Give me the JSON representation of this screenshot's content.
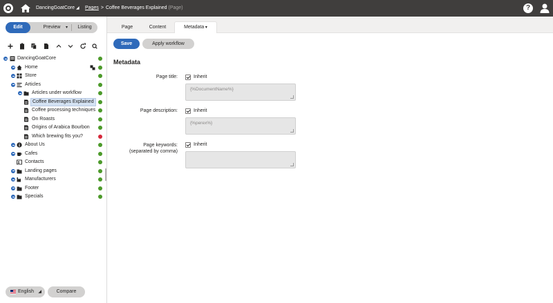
{
  "topbar": {
    "site_name": "DancingGoatCore",
    "breadcrumb_pages": "Pages",
    "breadcrumb_current": "Coffee Beverages Explained",
    "breadcrumb_suffix": "(Page)",
    "help_label": "?"
  },
  "modes": {
    "edit": "Edit",
    "preview": "Preview",
    "listing": "Listing"
  },
  "tree": {
    "items": [
      {
        "label": "DancingGoatCore",
        "icon": "site-icon",
        "status": "ok"
      },
      {
        "label": "Home",
        "icon": "home-icon",
        "status": "ok"
      },
      {
        "label": "Store",
        "icon": "store-icon",
        "status": "ok"
      },
      {
        "label": "Articles",
        "icon": "articles-icon",
        "status": "ok"
      },
      {
        "label": "Articles under workflow",
        "icon": "folder-icon",
        "status": "ok"
      },
      {
        "label": "Coffee Beverages Explained",
        "icon": "document-icon",
        "status": "ok",
        "selected": true
      },
      {
        "label": "Coffee processing techniques",
        "icon": "document-icon",
        "status": "ok"
      },
      {
        "label": "On Roasts",
        "icon": "document-icon",
        "status": "ok"
      },
      {
        "label": "Origins of Arabica Bourbon",
        "icon": "document-icon",
        "status": "ok"
      },
      {
        "label": "Which brewing fits you?",
        "icon": "document-icon",
        "status": "error"
      },
      {
        "label": "About Us",
        "icon": "info-icon",
        "status": "ok"
      },
      {
        "label": "Cafes",
        "icon": "cup-icon",
        "status": "ok"
      },
      {
        "label": "Contacts",
        "icon": "contacts-icon",
        "status": "ok"
      },
      {
        "label": "Landing pages",
        "icon": "folder-icon",
        "status": "ok"
      },
      {
        "label": "Manufacturers",
        "icon": "factory-icon",
        "status": "ok"
      },
      {
        "label": "Footer",
        "icon": "folder-icon",
        "status": "ok"
      },
      {
        "label": "Specials",
        "icon": "folder-icon",
        "status": "ok"
      }
    ]
  },
  "bottom": {
    "language": "English",
    "compare": "Compare"
  },
  "tabs": {
    "page": "Page",
    "content": "Content",
    "metadata": "Metadata"
  },
  "actions": {
    "save": "Save",
    "apply_workflow": "Apply workflow"
  },
  "form": {
    "section_title": "Metadata",
    "page_title_label": "Page title:",
    "page_title_inherit": "Inherit",
    "page_title_value": "{%DocumentName%}",
    "page_description_label": "Page description:",
    "page_description_inherit": "Inherit",
    "page_description_value": "{%perex%}",
    "page_keywords_label": "Page keywords:",
    "page_keywords_sublabel": "(separated by comma)",
    "page_keywords_inherit": "Inherit",
    "page_keywords_value": ""
  },
  "colors": {
    "topbar": "#403e3d",
    "accent": "#2f6aba",
    "ok": "#4c9a2a",
    "error": "#d6283a"
  }
}
